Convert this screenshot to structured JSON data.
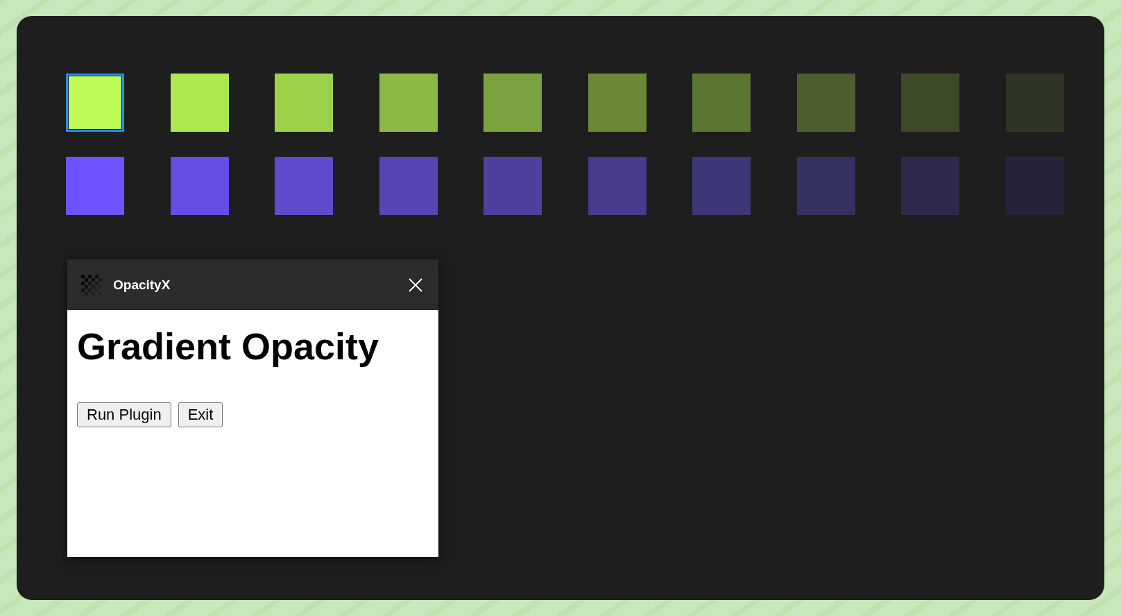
{
  "swatch_rows": [
    {
      "swatches": [
        {
          "color": "#bdfc57",
          "selected": true
        },
        {
          "color": "#aee84f",
          "selected": false
        },
        {
          "color": "#9dd14a",
          "selected": false
        },
        {
          "color": "#8cb945",
          "selected": false
        },
        {
          "color": "#7ca23f",
          "selected": false
        },
        {
          "color": "#6b8a38",
          "selected": false
        },
        {
          "color": "#5b7533",
          "selected": false
        },
        {
          "color": "#4c5e2e",
          "selected": false
        },
        {
          "color": "#3c4a28",
          "selected": false
        },
        {
          "color": "#2e3524",
          "selected": false
        }
      ]
    },
    {
      "swatches": [
        {
          "color": "#6e51ff",
          "selected": false
        },
        {
          "color": "#674ce6",
          "selected": false
        },
        {
          "color": "#5f49cd",
          "selected": false
        },
        {
          "color": "#5645b5",
          "selected": false
        },
        {
          "color": "#4d409e",
          "selected": false
        },
        {
          "color": "#463b8c",
          "selected": false
        },
        {
          "color": "#3d3677",
          "selected": false
        },
        {
          "color": "#353062",
          "selected": false
        },
        {
          "color": "#2d2a4d",
          "selected": false
        },
        {
          "color": "#27243a",
          "selected": false
        }
      ]
    }
  ],
  "dialog": {
    "title": "OpacityX",
    "heading": "Gradient Opacity",
    "buttons": [
      "Run Plugin",
      "Exit"
    ]
  }
}
